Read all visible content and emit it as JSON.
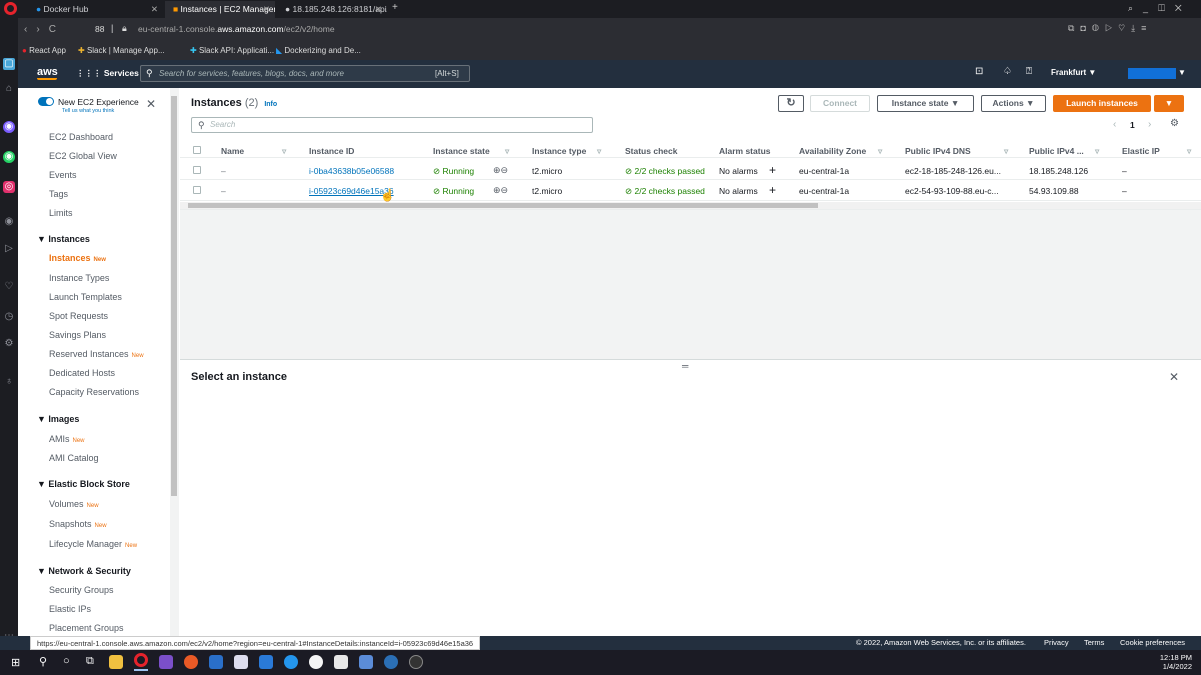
{
  "browser": {
    "tabs": [
      {
        "label": "Docker Hub"
      },
      {
        "label": "Instances | EC2 Manageme"
      },
      {
        "label": "18.185.248.126:8181/api/"
      }
    ],
    "url_prefix": "eu-central-1.console.",
    "url_domain": "aws.amazon.com",
    "url_suffix": "/ec2/v2/home",
    "speed_dial_count": "88",
    "bookmarks": [
      "React App",
      "Slack | Manage App...",
      "Slack API: Applicati...",
      "Dockerizing and De..."
    ]
  },
  "aws_nav": {
    "logo": "aws",
    "services_label": "Services",
    "search_placeholder": "Search for services, features, blogs, docs, and more",
    "search_shortcut": "[Alt+S]",
    "region": "Frankfurt ▼"
  },
  "sidebar": {
    "new_experience_label": "New EC2 Experience",
    "new_experience_sub": "Tell us what you think",
    "top_items": [
      "EC2 Dashboard",
      "EC2 Global View",
      "Events",
      "Tags",
      "Limits"
    ],
    "sections": [
      {
        "title": "▼ Instances",
        "items": [
          {
            "label": "Instances",
            "new": "New",
            "active": true
          },
          {
            "label": "Instance Types"
          },
          {
            "label": "Launch Templates"
          },
          {
            "label": "Spot Requests"
          },
          {
            "label": "Savings Plans"
          },
          {
            "label": "Reserved Instances",
            "new": "New"
          },
          {
            "label": "Dedicated Hosts"
          },
          {
            "label": "Capacity Reservations"
          }
        ]
      },
      {
        "title": "▼ Images",
        "items": [
          {
            "label": "AMIs",
            "new": "New"
          },
          {
            "label": "AMI Catalog"
          }
        ]
      },
      {
        "title": "▼ Elastic Block Store",
        "items": [
          {
            "label": "Volumes",
            "new": "New"
          },
          {
            "label": "Snapshots",
            "new": "New"
          },
          {
            "label": "Lifecycle Manager",
            "new": "New"
          }
        ]
      },
      {
        "title": "▼ Network & Security",
        "items": [
          {
            "label": "Security Groups"
          },
          {
            "label": "Elastic IPs"
          },
          {
            "label": "Placement Groups"
          }
        ]
      }
    ]
  },
  "instances_panel": {
    "title": "Instances",
    "count": "(2)",
    "info": "Info",
    "search_placeholder": "Search",
    "connect": "Connect",
    "instance_state": "Instance state ▼",
    "actions": "Actions ▼",
    "launch": "Launch instances",
    "page": "1",
    "columns": [
      "Name",
      "Instance ID",
      "Instance state",
      "Instance type",
      "Status check",
      "Alarm status",
      "Availability Zone",
      "Public IPv4 DNS",
      "Public IPv4 ...",
      "Elastic IP"
    ],
    "rows": [
      {
        "name": "–",
        "id": "i-0ba43638b05e06588",
        "state": "Running",
        "type": "t2.micro",
        "check": "2/2 checks passed",
        "alarm": "No alarms",
        "az": "eu-central-1a",
        "dns": "ec2-18-185-248-126.eu...",
        "ip": "18.185.248.126",
        "eip": "–"
      },
      {
        "name": "–",
        "id": "i-05923c69d46e15a36",
        "state": "Running",
        "type": "t2.micro",
        "check": "2/2 checks passed",
        "alarm": "No alarms",
        "az": "eu-central-1a",
        "dns": "ec2-54-93-109-88.eu-c...",
        "ip": "54.93.109.88",
        "eip": "–"
      }
    ]
  },
  "detail_panel": {
    "title": "Select an instance"
  },
  "status_bar": {
    "url": "https://eu-central-1.console.aws.amazon.com/ec2/v2/home?region=eu-central-1#InstanceDetails:instanceId=i-05923c69d46e15a36",
    "copyright": "© 2022, Amazon Web Services, Inc. or its affiliates.",
    "links": [
      "Privacy",
      "Terms",
      "Cookie preferences"
    ]
  },
  "taskbar": {
    "time": "12:18 PM",
    "date": "1/4/2022"
  },
  "colors": {
    "aws_nav": "#232f3e",
    "launch_button": "#ec7211",
    "link": "#0073bb",
    "running": "#1d8102"
  }
}
